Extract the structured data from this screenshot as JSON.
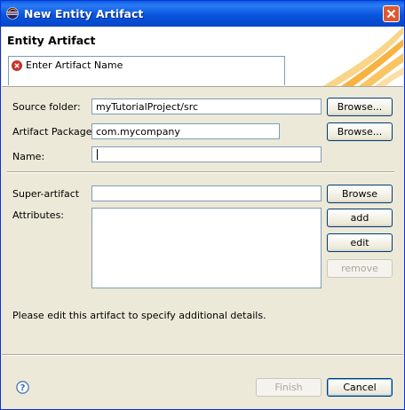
{
  "window": {
    "title": "New Entity Artifact"
  },
  "header": {
    "heading": "Entity Artifact",
    "message": "Enter Artifact Name"
  },
  "form": {
    "source_folder": {
      "label": "Source folder:",
      "value": "myTutorialProject/src",
      "browse_label": "Browse..."
    },
    "artifact_package": {
      "label": "Artifact Package:",
      "value": "com.mycompany",
      "browse_label": "Browse..."
    },
    "name": {
      "label": "Name:",
      "value": ""
    },
    "super_artifact": {
      "label": "Super-artifact",
      "value": "",
      "browse_label": "Browse"
    },
    "attributes": {
      "label": "Attributes:",
      "add_label": "add",
      "edit_label": "edit",
      "remove_label": "remove"
    },
    "hint": "Please edit this artifact to specify additional details."
  },
  "footer": {
    "finish_label": "Finish",
    "cancel_label": "Cancel"
  },
  "icons": {
    "app": "eclipse-icon",
    "close": "close-icon",
    "error": "error-icon",
    "help": "help-icon"
  },
  "colors": {
    "titlebar": "#0855dd",
    "dialog_bg": "#ece9d8",
    "close_button": "#e0572e",
    "error": "#d0342c"
  }
}
